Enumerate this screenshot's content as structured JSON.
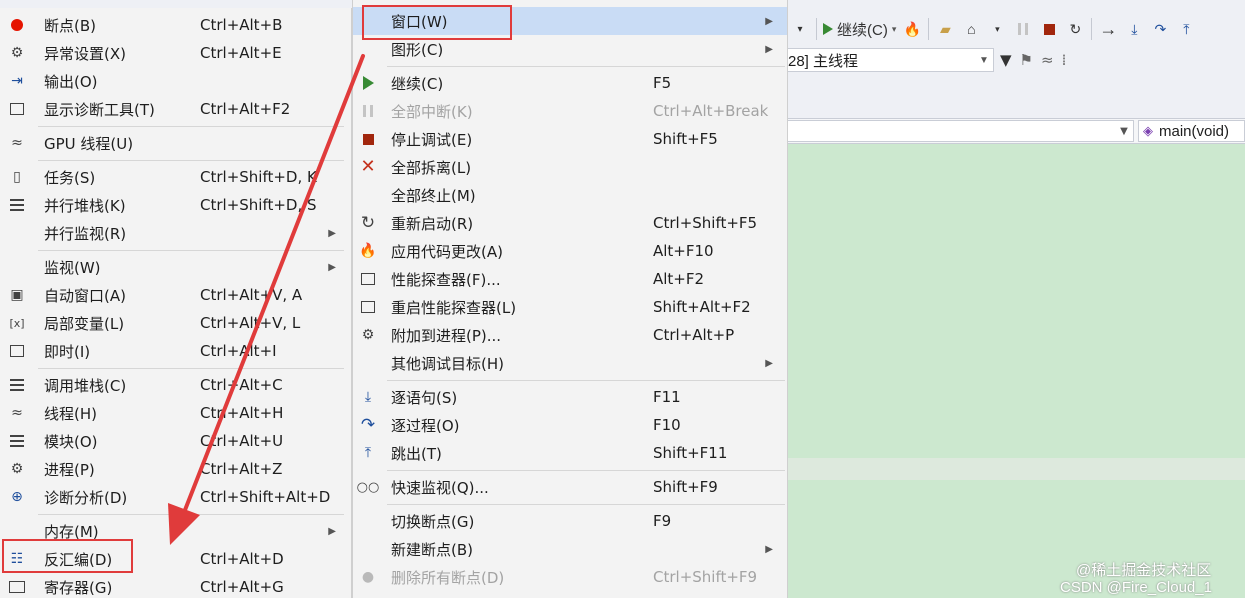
{
  "toolbar": {
    "continue_label": "继续(C)",
    "thread_label": "28] 主线程",
    "function_scope": "main(void)"
  },
  "windows_submenu": {
    "items": [
      {
        "label": "断点(B)",
        "shortcut": "Ctrl+Alt+B",
        "icon": "breakpoint-icon"
      },
      {
        "label": "异常设置(X)",
        "shortcut": "Ctrl+Alt+E",
        "icon": "exception-settings-icon"
      },
      {
        "label": "输出(O)",
        "shortcut": "",
        "icon": "output-icon"
      },
      {
        "label": "显示诊断工具(T)",
        "shortcut": "Ctrl+Alt+F2",
        "icon": "diagnostic-tools-icon"
      },
      {
        "label": "GPU 线程(U)",
        "shortcut": "",
        "icon": "gpu-threads-icon"
      },
      {
        "label": "任务(S)",
        "shortcut": "Ctrl+Shift+D, K",
        "icon": "tasks-icon"
      },
      {
        "label": "并行堆栈(K)",
        "shortcut": "Ctrl+Shift+D, S",
        "icon": "parallel-stacks-icon"
      },
      {
        "label": "并行监视(R)",
        "shortcut": "",
        "icon": ""
      },
      {
        "label": "监视(W)",
        "shortcut": "",
        "icon": ""
      },
      {
        "label": "自动窗口(A)",
        "shortcut": "Ctrl+Alt+V, A",
        "icon": "autos-icon"
      },
      {
        "label": "局部变量(L)",
        "shortcut": "Ctrl+Alt+V, L",
        "icon": "locals-icon"
      },
      {
        "label": "即时(I)",
        "shortcut": "Ctrl+Alt+I",
        "icon": "immediate-icon"
      },
      {
        "label": "调用堆栈(C)",
        "shortcut": "Ctrl+Alt+C",
        "icon": "call-stack-icon"
      },
      {
        "label": "线程(H)",
        "shortcut": "Ctrl+Alt+H",
        "icon": "threads-icon"
      },
      {
        "label": "模块(O)",
        "shortcut": "Ctrl+Alt+U",
        "icon": "modules-icon"
      },
      {
        "label": "进程(P)",
        "shortcut": "Ctrl+Alt+Z",
        "icon": "processes-icon"
      },
      {
        "label": "诊断分析(D)",
        "shortcut": "Ctrl+Shift+Alt+D",
        "icon": "diagnostic-analysis-icon"
      },
      {
        "label": "内存(M)",
        "shortcut": "",
        "icon": ""
      },
      {
        "label": "反汇编(D)",
        "shortcut": "Ctrl+Alt+D",
        "icon": "disassembly-icon"
      },
      {
        "label": "寄存器(G)",
        "shortcut": "Ctrl+Alt+G",
        "icon": "registers-icon"
      }
    ]
  },
  "debug_menu": {
    "items": [
      {
        "label": "窗口(W)",
        "shortcut": ""
      },
      {
        "label": "图形(C)",
        "shortcut": ""
      },
      {
        "label": "继续(C)",
        "shortcut": "F5"
      },
      {
        "label": "全部中断(K)",
        "shortcut": "Ctrl+Alt+Break"
      },
      {
        "label": "停止调试(E)",
        "shortcut": "Shift+F5"
      },
      {
        "label": "全部拆离(L)",
        "shortcut": ""
      },
      {
        "label": "全部终止(M)",
        "shortcut": ""
      },
      {
        "label": "重新启动(R)",
        "shortcut": "Ctrl+Shift+F5"
      },
      {
        "label": "应用代码更改(A)",
        "shortcut": "Alt+F10"
      },
      {
        "label": "性能探查器(F)...",
        "shortcut": "Alt+F2"
      },
      {
        "label": "重启性能探查器(L)",
        "shortcut": "Shift+Alt+F2"
      },
      {
        "label": "附加到进程(P)...",
        "shortcut": "Ctrl+Alt+P"
      },
      {
        "label": "其他调试目标(H)",
        "shortcut": ""
      },
      {
        "label": "逐语句(S)",
        "shortcut": "F11"
      },
      {
        "label": "逐过程(O)",
        "shortcut": "F10"
      },
      {
        "label": "跳出(T)",
        "shortcut": "Shift+F11"
      },
      {
        "label": "快速监视(Q)...",
        "shortcut": "Shift+F9"
      },
      {
        "label": "切换断点(G)",
        "shortcut": "F9"
      },
      {
        "label": "新建断点(B)",
        "shortcut": ""
      },
      {
        "label": "删除所有断点(D)",
        "shortcut": "Ctrl+Shift+F9"
      }
    ]
  },
  "watermark": {
    "line1": "@稀土掘金技术社区",
    "line2": "CSDN @Fire_Cloud_1"
  },
  "colors": {
    "highlight": "#c9dcf5",
    "annotation_red": "#e03b3b",
    "editor_bg": "#cce8cf"
  }
}
